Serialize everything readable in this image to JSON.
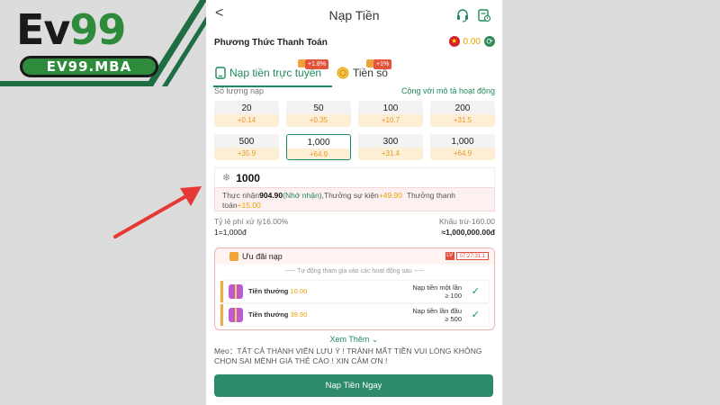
{
  "brand": {
    "logo_main_prefix": "Ev",
    "logo_main_suffix": "99",
    "logo_sub": "EV99.MBA",
    "colors": {
      "brand_green": "#2e8b3c",
      "arrow_red": "#e53935"
    }
  },
  "header": {
    "back": "<",
    "title": "Nạp Tiền",
    "support_icon": "headset-icon",
    "history_icon": "history-icon"
  },
  "method": {
    "label": "Phương Thức Thanh Toán",
    "balance": "0.00"
  },
  "tabs": [
    {
      "label": "Nạp tiền trực tuyến",
      "badge": "+1.8%",
      "active": true
    },
    {
      "label": "Tiền số",
      "badge": "+1%",
      "active": false
    }
  ],
  "amounts": {
    "header_left": "Số lượng nạp",
    "header_right": "Cộng với mô tả hoạt động",
    "items": [
      {
        "value": "20",
        "bonus": "+0.14"
      },
      {
        "value": "50",
        "bonus": "+0.35"
      },
      {
        "value": "100",
        "bonus": "+10.7"
      },
      {
        "value": "200",
        "bonus": "+31.5"
      },
      {
        "value": "500",
        "bonus": "+35.9"
      },
      {
        "value": "1,000",
        "bonus": "+64.9",
        "selected": true
      },
      {
        "value": "300",
        "bonus": "+31.4"
      },
      {
        "value": "1,000",
        "bonus": "+64.9"
      }
    ]
  },
  "input": {
    "value": "1000"
  },
  "received": {
    "prefix": "Thực nhận",
    "amount": "904.90",
    "note": "(Nhớ nhận)",
    "event_label": ",Thưởng sự kiện",
    "event_amount": "+49.90",
    "pay_label": "Thưởng thanh toán",
    "pay_amount": "+15.00"
  },
  "fees": {
    "rate_label": "Tỷ lệ phí xử lý16.00%",
    "deduct_label": "Khấu trừ",
    "deduct_value": "-160.00",
    "rate_conv": "1=1,000đ",
    "total": "≈1,000,000.00đ"
  },
  "offers": {
    "title": "Ưu đãi nạp",
    "timer_level": "LV",
    "timer": "07:27:31:1",
    "note": "----- Tự động tham gia vào các hoạt động sau -----",
    "rows": [
      {
        "label": "Tiền thưởng",
        "amount": "10.00",
        "cond_1": "Nạp tiền một lần",
        "cond_2": "≥ 100",
        "check": "✓"
      },
      {
        "label": "Tiền thưởng",
        "amount": "39.90",
        "cond_1": "Nạp tiền lần đầu",
        "cond_2": "≥ 500",
        "check": "✓"
      }
    ]
  },
  "more": "Xem Thêm",
  "note": "Mẹo：TẤT CẢ THÀNH VIÊN LƯU Ý ! TRÁNH MẤT TIỀN VUI LÒNG KHÔNG CHỌN SAI MỆNH GIÁ THẺ CÀO ! XIN CẢM ƠN !",
  "submit": "Nạp Tiền Ngay"
}
